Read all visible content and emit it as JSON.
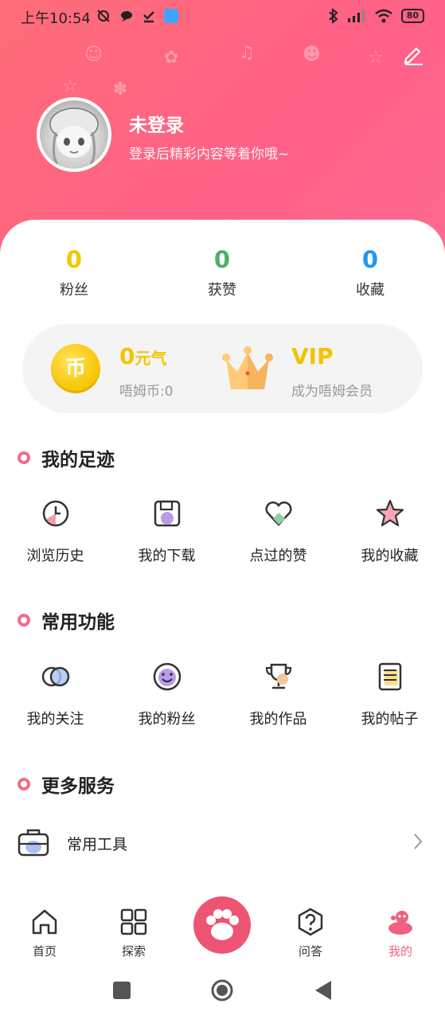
{
  "status_bar": {
    "time": "上午10:54",
    "battery": "80"
  },
  "profile": {
    "name": "未登录",
    "subtitle": "登录后精彩内容等着你哦~"
  },
  "stats": [
    {
      "value": "0",
      "label": "粉丝",
      "color": "#f2c700"
    },
    {
      "value": "0",
      "label": "获赞",
      "color": "#4caf6a"
    },
    {
      "value": "0",
      "label": "收藏",
      "color": "#2196f3"
    }
  ],
  "wallet": {
    "coin_symbol": "币",
    "coin_amount": "0",
    "coin_unit": "元气",
    "coin_label": "唔姆币:0",
    "vip_title": "VIP",
    "vip_label": "成为唔姆会员"
  },
  "sections": {
    "footprints": {
      "title": "我的足迹",
      "items": [
        {
          "label": "浏览历史",
          "icon": "clock-icon"
        },
        {
          "label": "我的下载",
          "icon": "save-icon"
        },
        {
          "label": "点过的赞",
          "icon": "heart-icon"
        },
        {
          "label": "我的收藏",
          "icon": "star-icon"
        }
      ]
    },
    "common": {
      "title": "常用功能",
      "items": [
        {
          "label": "我的关注",
          "icon": "follow-icon"
        },
        {
          "label": "我的粉丝",
          "icon": "smile-icon"
        },
        {
          "label": "我的作品",
          "icon": "trophy-icon"
        },
        {
          "label": "我的帖子",
          "icon": "note-icon"
        }
      ]
    },
    "more": {
      "title": "更多服务",
      "tools": {
        "label": "常用工具",
        "icon": "toolbox-icon"
      }
    }
  },
  "tabbar": [
    {
      "label": "首页",
      "icon": "home-icon"
    },
    {
      "label": "探索",
      "icon": "grid-icon"
    },
    {
      "label": "",
      "icon": "paw-icon"
    },
    {
      "label": "问答",
      "icon": "question-icon"
    },
    {
      "label": "我的",
      "icon": "mine-icon",
      "active": true
    }
  ],
  "colors": {
    "accent": "#f0607f",
    "header": "#ff6580",
    "gold": "#f4c300"
  }
}
